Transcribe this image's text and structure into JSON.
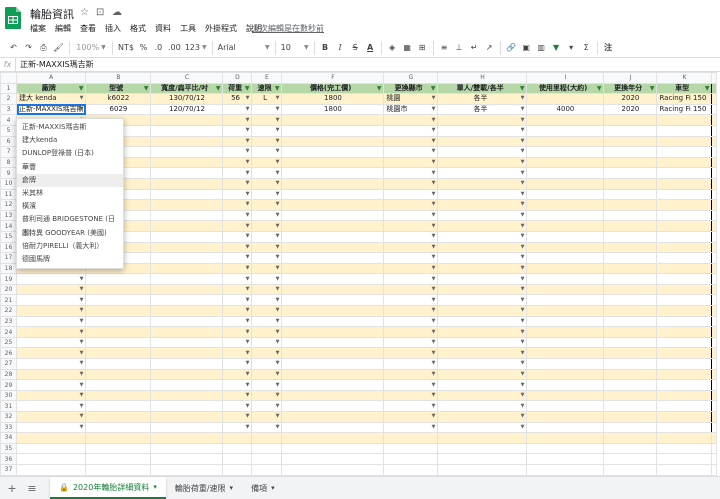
{
  "app": {
    "doc_title": "輪胎資訊",
    "menu": [
      "檔案",
      "編輯",
      "查看",
      "插入",
      "格式",
      "資料",
      "工具",
      "外掛程式",
      "說明"
    ],
    "last_edit": "上次編輯是在數秒前"
  },
  "toolbar": {
    "zoom": "100%",
    "currency": "NT$",
    "percent": "%",
    "dec_dec": ".0",
    "dec_inc": ".00",
    "more_formats": "123",
    "font": "Arial",
    "font_size": "10",
    "bold": "B",
    "italic": "I",
    "strike": "S",
    "text_color": "A",
    "sum": "Σ",
    "input_tools": "注"
  },
  "formula_bar": {
    "fx": "fx",
    "value": "正新-MAXXIS瑪吉斯"
  },
  "columns": [
    "A",
    "B",
    "C",
    "D",
    "E",
    "F",
    "G",
    "H",
    "I",
    "J",
    "K"
  ],
  "headers": [
    "廠牌",
    "型號",
    "寬度/扁平比/吋",
    "荷重",
    "速限",
    "價格(完工價)",
    "更換縣市",
    "單人/雙載/各半",
    "使用里程(大約)",
    "更換年分",
    "車型"
  ],
  "rows": [
    [
      "建大 kenda",
      "k6022",
      "130/70/12",
      "56",
      "L",
      "1800",
      "桃園",
      "各半",
      "",
      "2020",
      "Racing Fi 150"
    ],
    [
      "正新-MAXXIS瑪吉斯",
      "6029",
      "120/70/12",
      "",
      "",
      "1800",
      "桃園市",
      "各半",
      "4000",
      "2020",
      "Racing Fi 150"
    ]
  ],
  "row_numbers": [
    "1",
    "2",
    "3",
    "4",
    "5",
    "6",
    "7",
    "8",
    "9",
    "10",
    "11",
    "12",
    "13",
    "14",
    "15",
    "16",
    "17",
    "18",
    "19",
    "20",
    "21",
    "22",
    "23",
    "24",
    "25",
    "26",
    "27",
    "28",
    "29",
    "30",
    "31",
    "32",
    "33",
    "34",
    "35",
    "36",
    "37"
  ],
  "dropdown_options": [
    "正新-MAXXIS瑪吉斯",
    "建大kenda",
    "DUNLOP登祿普 (日本)",
    "華豐",
    "倉牌",
    "米其林",
    "橫濱",
    "普利司通 BRIDGESTONE (日本)",
    "固特異 GOODYEAR (美國)",
    "倍耐力PIRELLI（義大利）",
    "德國馬牌"
  ],
  "dropdown_highlight_index": 4,
  "tabs": {
    "add": "+",
    "list": "≡",
    "items": [
      {
        "label": "2020年輪胎詳細資料",
        "active": true,
        "locked": true
      },
      {
        "label": "輪胎荷重/速限",
        "active": false,
        "locked": false
      },
      {
        "label": "備項",
        "active": false,
        "locked": false
      }
    ]
  },
  "colors": {
    "header_fill": "#b6d7a8",
    "band_fill": "#fff2cc",
    "accent": "#188038",
    "selection": "#1a73e8"
  }
}
